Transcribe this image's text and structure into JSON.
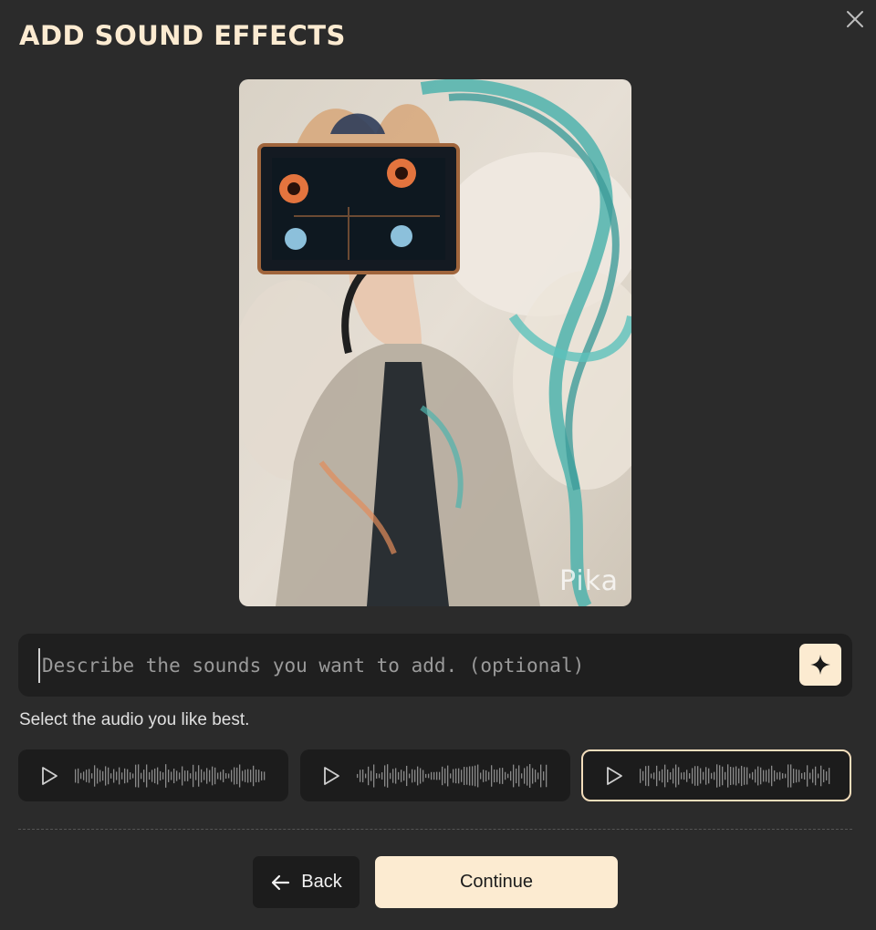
{
  "dialog": {
    "title": "ADD SOUND EFFECTS"
  },
  "preview": {
    "watermark": "Pika"
  },
  "prompt": {
    "placeholder": "Describe the sounds you want to add. (optional)",
    "value": ""
  },
  "hint": "Select the audio you like best.",
  "audio_options": [
    {
      "selected": false
    },
    {
      "selected": false
    },
    {
      "selected": true
    }
  ],
  "buttons": {
    "back_label": "Back",
    "continue_label": "Continue"
  },
  "colors": {
    "background": "#2b2b2b",
    "accent": "#fcebd1",
    "panel": "#1f1f1f"
  },
  "icons": [
    "close-icon",
    "sparkle-icon",
    "play-icon",
    "arrow-left-icon"
  ]
}
